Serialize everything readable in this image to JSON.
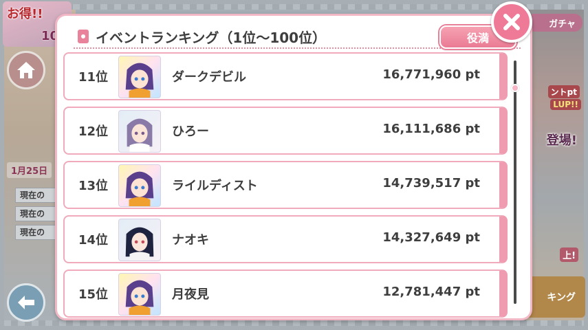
{
  "background": {
    "deal_banner": {
      "text": "お得!!",
      "number": "10"
    },
    "date": "1月25日",
    "status_rows": [
      "現在の",
      "現在の",
      "現在の"
    ],
    "gacha_tag": "ガチャ",
    "promo_lines": [
      "ントpt",
      "LUP!!",
      "登場!",
      "上!"
    ],
    "ranking_button": "キング"
  },
  "modal": {
    "title": "イベントランキング（1位～100位）",
    "role_button": "役満",
    "entries": [
      {
        "rank": "11位",
        "name": "ダークデビル",
        "points": "16,771,960 pt"
      },
      {
        "rank": "12位",
        "name": "ひろー",
        "points": "16,111,686 pt"
      },
      {
        "rank": "13位",
        "name": "ライルディスト",
        "points": "14,739,517 pt"
      },
      {
        "rank": "14位",
        "name": "ナオキ",
        "points": "14,327,649 pt"
      },
      {
        "rank": "15位",
        "name": "月夜見",
        "points": "12,781,447 pt"
      }
    ],
    "scroll_position": 0.1
  },
  "colors": {
    "accent_pink": "#ef7a97",
    "row_border": "#f0aabb",
    "text": "#3e3e3e"
  },
  "icons": {
    "close": "close-icon",
    "home": "home-icon",
    "back": "back-arrow-icon",
    "title": "card-icon"
  }
}
